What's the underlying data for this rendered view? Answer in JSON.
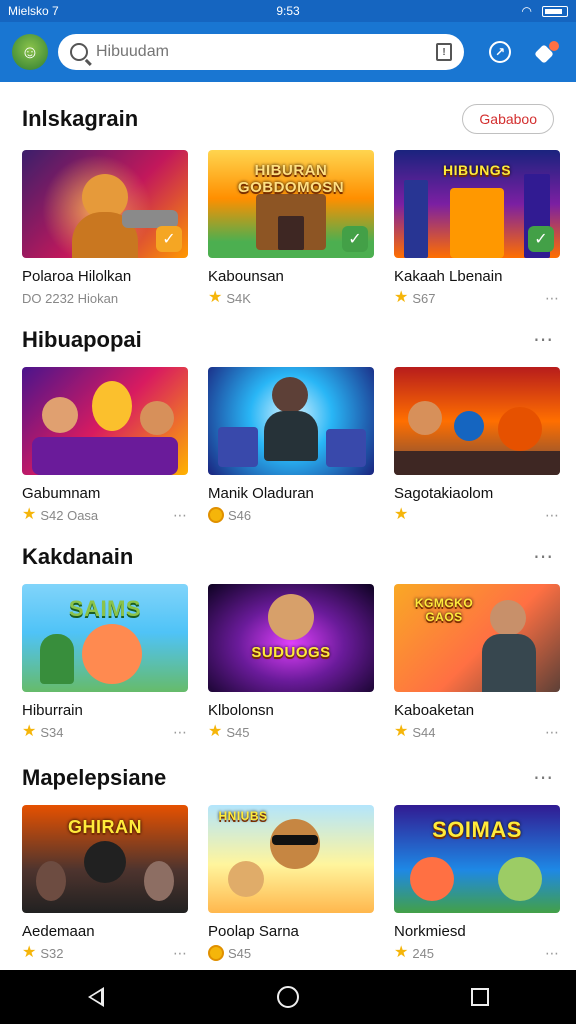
{
  "status_bar": {
    "left": "Mielsko 7",
    "time": "9:53"
  },
  "header": {
    "search_placeholder": "Hibuudam"
  },
  "sections": [
    {
      "title": "Inlskagrain",
      "action": "Gababoo",
      "cards": [
        {
          "title": "Polaroa Hilolkan",
          "meta": "DO 2232 Hiokan",
          "icon": "none",
          "thumb": "hero-cannon",
          "checked": true,
          "check_color": "#f5a623"
        },
        {
          "title": "Kabounsan",
          "meta": "S4K",
          "icon": "star-icon",
          "thumb": "town-hall",
          "checked": true,
          "check_color": "#43a047",
          "banner": "HIBURAN GOBDOMOSN"
        },
        {
          "title": "Kakaah Lbenain",
          "meta": "S67",
          "icon": "star-icon",
          "thumb": "neon-city",
          "checked": true,
          "check_color": "#43a047",
          "banner": "HIBUNGS"
        }
      ]
    },
    {
      "title": "Hibuapopai",
      "cards": [
        {
          "title": "Gabumnam",
          "meta": "S42 Oasa",
          "icon": "star-icon",
          "thumb": "party-fight"
        },
        {
          "title": "Manik Oladuran",
          "meta": "S46",
          "icon": "coin-icon",
          "thumb": "blue-robot"
        },
        {
          "title": "Sagotakiaolom",
          "meta": "",
          "icon": "star-icon",
          "thumb": "crowd-battle"
        }
      ]
    },
    {
      "title": "Kakdanain",
      "cards": [
        {
          "title": "Hiburrain",
          "meta": "S34",
          "icon": "star-icon",
          "thumb": "saims-fox",
          "banner": "SAIMS"
        },
        {
          "title": "Klbolonsn",
          "meta": "S45",
          "icon": "star-icon",
          "thumb": "neon-hero",
          "banner": "SUDUOGS"
        },
        {
          "title": "Kaboaketan",
          "meta": "S44",
          "icon": "star-icon",
          "thumb": "game-shooter",
          "banner": "KGMGKO GAOS"
        }
      ]
    },
    {
      "title": "Mapelepsiane",
      "cards": [
        {
          "title": "Aedemaan",
          "meta": "S32",
          "icon": "star-icon",
          "thumb": "dark-team",
          "banner": "GHIRAN"
        },
        {
          "title": "Poolap Sarna",
          "meta": "S45",
          "icon": "coin-icon",
          "thumb": "sunglasses-hero",
          "banner": "HNIUBS"
        },
        {
          "title": "Norkmiesd",
          "meta": "245",
          "icon": "star-icon",
          "thumb": "somas-monsters",
          "banner": "SOIMAS"
        }
      ]
    }
  ],
  "colors": {
    "primary": "#1976d2",
    "status_bar": "#1565c0",
    "star": "#f5b50a",
    "accent_red": "#d32f2f"
  }
}
